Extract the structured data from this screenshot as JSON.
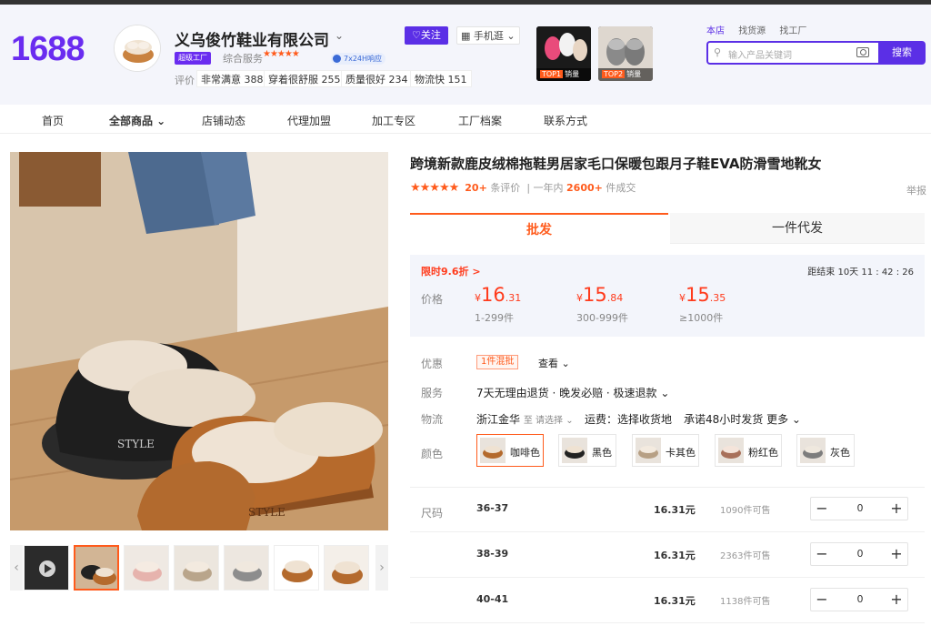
{
  "header": {
    "logo": "1688",
    "company": "义乌俊竹鞋业有限公司",
    "follow": "♡关注",
    "mobile": "▦ 手机逛 ⌄",
    "super_badge": "超级工厂",
    "service_label": "综合服务",
    "service_stars": "★★★★★",
    "response_badge": "7x24H响应",
    "review_label": "评价",
    "reviews": [
      "非常满意 388",
      "穿着很舒服 255",
      "质量很好 234",
      "物流快 151"
    ],
    "top_products": [
      {
        "rank": "TOP1",
        "label": "销量"
      },
      {
        "rank": "TOP2",
        "label": "销量"
      }
    ],
    "search_tabs": [
      "本店",
      "找货源",
      "找工厂"
    ],
    "search_placeholder": "输入产品关键词",
    "search_button": "搜索",
    "accent": "#5b2fe6"
  },
  "nav": [
    "首页",
    "全部商品 ⌄",
    "店铺动态",
    "代理加盟",
    "加工专区",
    "工厂档案",
    "联系方式"
  ],
  "product": {
    "title": "跨境新款鹿皮绒棉拖鞋男居家毛口保暖包跟月子鞋EVA防滑雪地靴女",
    "stars": "★★★★★",
    "review_count": "20+",
    "review_suffix": "条评价",
    "year_label": "| 一年内",
    "sold_count": "2600+",
    "sold_suffix": "件成交",
    "report": "举报"
  },
  "tabs": {
    "wholesale": "批发",
    "dropship": "一件代发"
  },
  "price_panel": {
    "promo": "限时9.6折 >",
    "countdown": "距结束  10天 11 : 42 : 26",
    "label": "价格",
    "tiers": [
      {
        "currency": "¥",
        "int": "16",
        "dec": ".31",
        "qty": "1-299件"
      },
      {
        "currency": "¥",
        "int": "15",
        "dec": ".84",
        "qty": "300-999件"
      },
      {
        "currency": "¥",
        "int": "15",
        "dec": ".35",
        "qty": "≥1000件"
      }
    ]
  },
  "discount": {
    "label": "优惠",
    "tag": "1件混批",
    "view": "查看 ⌄"
  },
  "service": {
    "label": "服务",
    "text": "7天无理由退货 · 晚发必赔 · 极速退款 ⌄"
  },
  "logistics": {
    "label": "物流",
    "from": "浙江金华",
    "to": "至 请选择 ⌄",
    "fee": "运费：选择收货地",
    "promise": "承诺48小时发货 更多 ⌄"
  },
  "colors": {
    "label": "颜色",
    "options": [
      "咖啡色",
      "黑色",
      "卡其色",
      "粉红色",
      "灰色"
    ]
  },
  "sizes": {
    "label": "尺码",
    "rows": [
      {
        "size": "36-37",
        "price": "16.31元",
        "stock": "1090件可售",
        "qty": "0"
      },
      {
        "size": "38-39",
        "price": "16.31元",
        "stock": "2363件可售",
        "qty": "0"
      },
      {
        "size": "40-41",
        "price": "16.31元",
        "stock": "1138件可售",
        "qty": "0"
      }
    ]
  }
}
